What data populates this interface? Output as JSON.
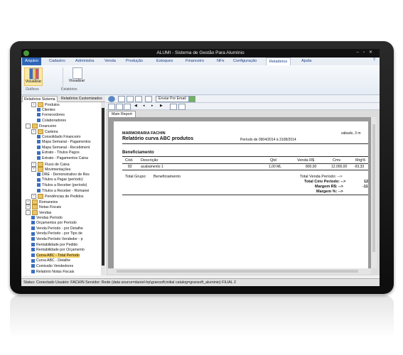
{
  "window": {
    "title": "ALUMI - Sistema de Gestão Para Alumínio"
  },
  "menu": {
    "items": [
      "Arquivo",
      "Cadastro",
      "Administra",
      "Venda",
      "Produção",
      "Estoques",
      "Financeiro",
      "NFe",
      "Configuração",
      "Relatórios",
      "Ajuda"
    ],
    "active": "Relatórios"
  },
  "ribbon": {
    "btn1": "Visualizar",
    "btn2": "Visualizar",
    "group1": "Gráficos",
    "group2": "Relatórios"
  },
  "left_tabs": [
    "Relatórios Sistema",
    "Relatórios Customizados"
  ],
  "tree": [
    {
      "label": "Produtos",
      "level": 1,
      "expander": "+",
      "icon": "folder"
    },
    {
      "label": "Clientes",
      "level": 2,
      "icon": "report"
    },
    {
      "label": "Fornecedores",
      "level": 2,
      "icon": "report"
    },
    {
      "label": "Colaboradores",
      "level": 2,
      "icon": "report"
    },
    {
      "label": "Financeiro",
      "level": 0,
      "expander": "-",
      "icon": "folder"
    },
    {
      "label": "Carteira",
      "level": 1,
      "expander": "+",
      "icon": "folder"
    },
    {
      "label": "Consolidado Financeiro",
      "level": 2,
      "icon": "report"
    },
    {
      "label": "Mapa Semanal - Pagamentos",
      "level": 2,
      "icon": "report"
    },
    {
      "label": "Mapa Semanal - Recebiment",
      "level": 2,
      "icon": "report"
    },
    {
      "label": "Extrato - Títulos Pagos",
      "level": 2,
      "icon": "report"
    },
    {
      "label": "Extrato - Pagamentos Caixa",
      "level": 2,
      "icon": "report"
    },
    {
      "label": "Fluxo de Caixa",
      "level": 1,
      "expander": "+",
      "icon": "folder"
    },
    {
      "label": "Movimentações",
      "level": 1,
      "expander": "+",
      "icon": "folder"
    },
    {
      "label": "DRE - Demonstrativo de Res",
      "level": 2,
      "icon": "report"
    },
    {
      "label": "Títulos a Pagar (período)",
      "level": 2,
      "icon": "report"
    },
    {
      "label": "Títulos a Receber (período)",
      "level": 2,
      "icon": "report"
    },
    {
      "label": "Títulos a Receber - Romanei",
      "level": 2,
      "icon": "report"
    },
    {
      "label": "Pendências de Pedidos",
      "level": 1,
      "expander": "+",
      "icon": "folder"
    },
    {
      "label": "Romaneios",
      "level": 0,
      "expander": "+",
      "icon": "folder"
    },
    {
      "label": "Notas Fiscais",
      "level": 0,
      "expander": "+",
      "icon": "folder"
    },
    {
      "label": "Vendas",
      "level": 0,
      "expander": "-",
      "icon": "folder"
    },
    {
      "label": "Vendas Período",
      "level": 1,
      "icon": "report"
    },
    {
      "label": "Orçamentos por Período",
      "level": 1,
      "icon": "report"
    },
    {
      "label": "Venda Período - por Detalhe",
      "level": 1,
      "icon": "report"
    },
    {
      "label": "Venda Período - por Tipo de",
      "level": 1,
      "icon": "report"
    },
    {
      "label": "Venda Período Vendedor - p",
      "level": 1,
      "icon": "report"
    },
    {
      "label": "Rentabilidade por Pedido",
      "level": 1,
      "icon": "report"
    },
    {
      "label": "Rentabilidade por Orçamento",
      "level": 1,
      "icon": "report"
    },
    {
      "label": "Curva ABC - Total Período",
      "level": 1,
      "icon": "report",
      "selected": true
    },
    {
      "label": "Curva ABC - Detalhe",
      "level": 1,
      "icon": "report"
    },
    {
      "label": "Comissão Vendedores",
      "level": 1,
      "icon": "report"
    },
    {
      "label": "Relatório Notas Fiscais",
      "level": 1,
      "icon": "report"
    }
  ],
  "toolbar": {
    "email": "Enviar Por Email"
  },
  "doc_tab": "Main Report",
  "report": {
    "company": "MARMORARIA FACHIN",
    "date": "sábado, 3 m",
    "title": "Relatório curva ABC produtos",
    "period": "Período de 0904/2014 à 3108/2014",
    "group": "Beneficiamento",
    "columns": [
      "Cód.",
      "Descrição",
      "Qtd",
      "Venda R$",
      "Cmv",
      "Mrg%"
    ],
    "row": [
      "83",
      "acabamento 1",
      "1,00 ML",
      "800,00",
      "12.000,00",
      "-93,33"
    ],
    "total_group_label": "Total Grupo:",
    "total_group_value": "Beneficiamento",
    "totals": [
      {
        "label": "Total Venda Período: -->",
        "value": ""
      },
      {
        "label": "Total Cmv Período: -->",
        "value": "12"
      },
      {
        "label": "Margem R$: -->",
        "value": "-11"
      },
      {
        "label": "Margem %: -->",
        "value": ""
      }
    ]
  },
  "status": "Status: Conectado   Usuário: FACHIN   Servidor: Rede (data source=daniel-hp\\gransoft;initial catalog=gransoft_aluminio)   FILIAL 2"
}
